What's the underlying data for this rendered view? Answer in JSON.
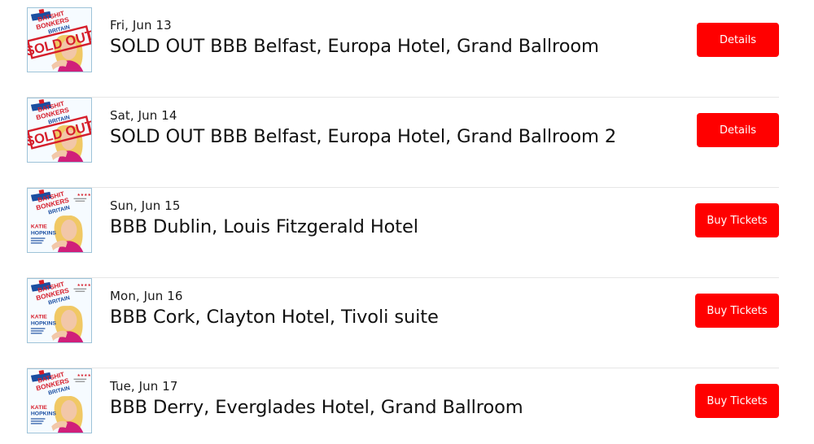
{
  "events": [
    {
      "date": "Fri, Jun 13",
      "title": "SOLD OUT BBB Belfast, Europa Hotel, Grand Ballroom",
      "button_label": "Details",
      "poster": {
        "variant": "sold-out",
        "stamp_text": "SOLD OUT",
        "banner_text": [
          "BATSHIT",
          "BONKERS",
          "BRITAIN"
        ]
      }
    },
    {
      "date": "Sat, Jun 14",
      "title": "SOLD OUT BBB Belfast, Europa Hotel, Grand Ballroom 2",
      "button_label": "Details",
      "poster": {
        "variant": "sold-out",
        "stamp_text": "SOLD OUT",
        "banner_text": [
          "BATSHIT",
          "BONKERS",
          "BRITAIN"
        ]
      }
    },
    {
      "date": "Sun, Jun 15",
      "title": "BBB Dublin, Louis Fitzgerald Hotel",
      "button_label": "Buy Tickets",
      "poster": {
        "variant": "on-sale",
        "banner_text": [
          "BATSHIT",
          "BONKERS",
          "BRITAIN"
        ],
        "name_text": [
          "KATIE",
          "HOPKINS"
        ]
      }
    },
    {
      "date": "Mon, Jun 16",
      "title": "BBB Cork, Clayton Hotel, Tivoli suite",
      "button_label": "Buy Tickets",
      "poster": {
        "variant": "on-sale",
        "banner_text": [
          "BATSHIT",
          "BONKERS",
          "BRITAIN"
        ],
        "name_text": [
          "KATIE",
          "HOPKINS"
        ]
      }
    },
    {
      "date": "Tue, Jun 17",
      "title": "BBB Derry, Everglades Hotel, Grand Ballroom",
      "button_label": "Buy Tickets",
      "poster": {
        "variant": "on-sale",
        "banner_text": [
          "BATSHIT",
          "BONKERS",
          "BRITAIN"
        ],
        "name_text": [
          "KATIE",
          "HOPKINS"
        ]
      }
    }
  ],
  "colors": {
    "button_bg": "#ff0000",
    "button_text": "#ffffff",
    "title_text": "#111111",
    "separator": "#e6e6e6",
    "poster_red": "#d61e2b",
    "poster_blue": "#1a4ea1",
    "hair": "#f0c864",
    "skin": "#f2c7a8",
    "top": "#d01f7a"
  }
}
